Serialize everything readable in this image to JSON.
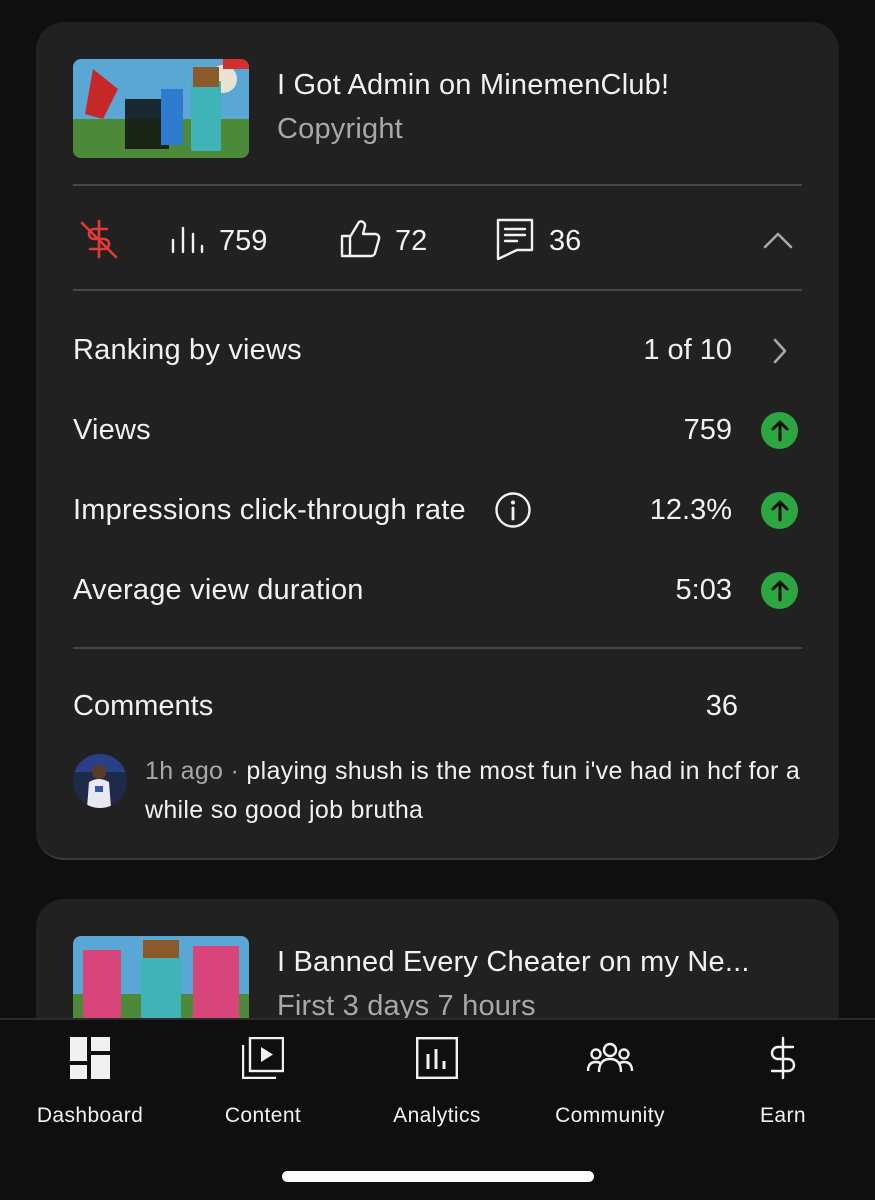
{
  "video_1": {
    "title": "I Got Admin on MinemenClub!",
    "subtitle": "Copyright",
    "thumbnail_icon": "minecraft-admin-thumbnail",
    "monetization_icon": "monetization-off-icon",
    "monetization_color": "#e53935",
    "stats": {
      "views": "759",
      "likes": "72",
      "comments": "36"
    },
    "metrics": [
      {
        "label": "Ranking by views",
        "value": "1 of 10"
      },
      {
        "label": "Views",
        "value": "759"
      },
      {
        "label": "Impressions click-through rate",
        "value": "12.3%"
      },
      {
        "label": "Average view duration",
        "value": "5:03"
      }
    ],
    "trend_color": "#2ba640",
    "comments_label": "Comments",
    "comments_count": "36",
    "comment": {
      "time": "1h ago",
      "separator": " · ",
      "text": "playing shush is the most fun i've had in hcf for a while so good job brutha"
    }
  },
  "video_2": {
    "title": "I Banned Every Cheater on my Ne...",
    "subtitle": "First 3 days 7 hours",
    "thumbnail_icon": "minecraft-ban-thumbnail"
  },
  "nav": {
    "items": [
      {
        "label": "Dashboard",
        "icon": "dashboard-icon"
      },
      {
        "label": "Content",
        "icon": "content-icon"
      },
      {
        "label": "Analytics",
        "icon": "analytics-icon"
      },
      {
        "label": "Community",
        "icon": "community-icon"
      },
      {
        "label": "Earn",
        "icon": "earn-icon"
      }
    ]
  }
}
